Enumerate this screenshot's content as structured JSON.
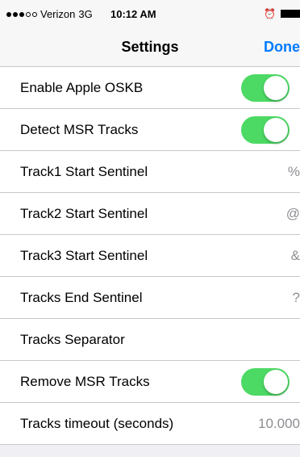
{
  "status": {
    "carrier": "Verizon",
    "network": "3G",
    "time": "10:12 AM"
  },
  "nav": {
    "title": "Settings",
    "done_label": "Done"
  },
  "rows": [
    {
      "label": "Enable Apple OSKB",
      "type": "toggle",
      "on": true
    },
    {
      "label": "Detect MSR Tracks",
      "type": "toggle",
      "on": true
    },
    {
      "label": "Track1 Start Sentinel",
      "type": "value",
      "value": "%"
    },
    {
      "label": "Track2 Start Sentinel",
      "type": "value",
      "value": "@"
    },
    {
      "label": "Track3 Start Sentinel",
      "type": "value",
      "value": "&"
    },
    {
      "label": "Tracks End Sentinel",
      "type": "value",
      "value": "?"
    },
    {
      "label": "Tracks Separator",
      "type": "value",
      "value": ""
    },
    {
      "label": "Remove MSR Tracks",
      "type": "toggle",
      "on": true
    },
    {
      "label": "Tracks timeout (seconds)",
      "type": "value",
      "value": "10.000"
    }
  ],
  "colors": {
    "toggle_on": "#4cd964",
    "accent": "#007aff"
  }
}
